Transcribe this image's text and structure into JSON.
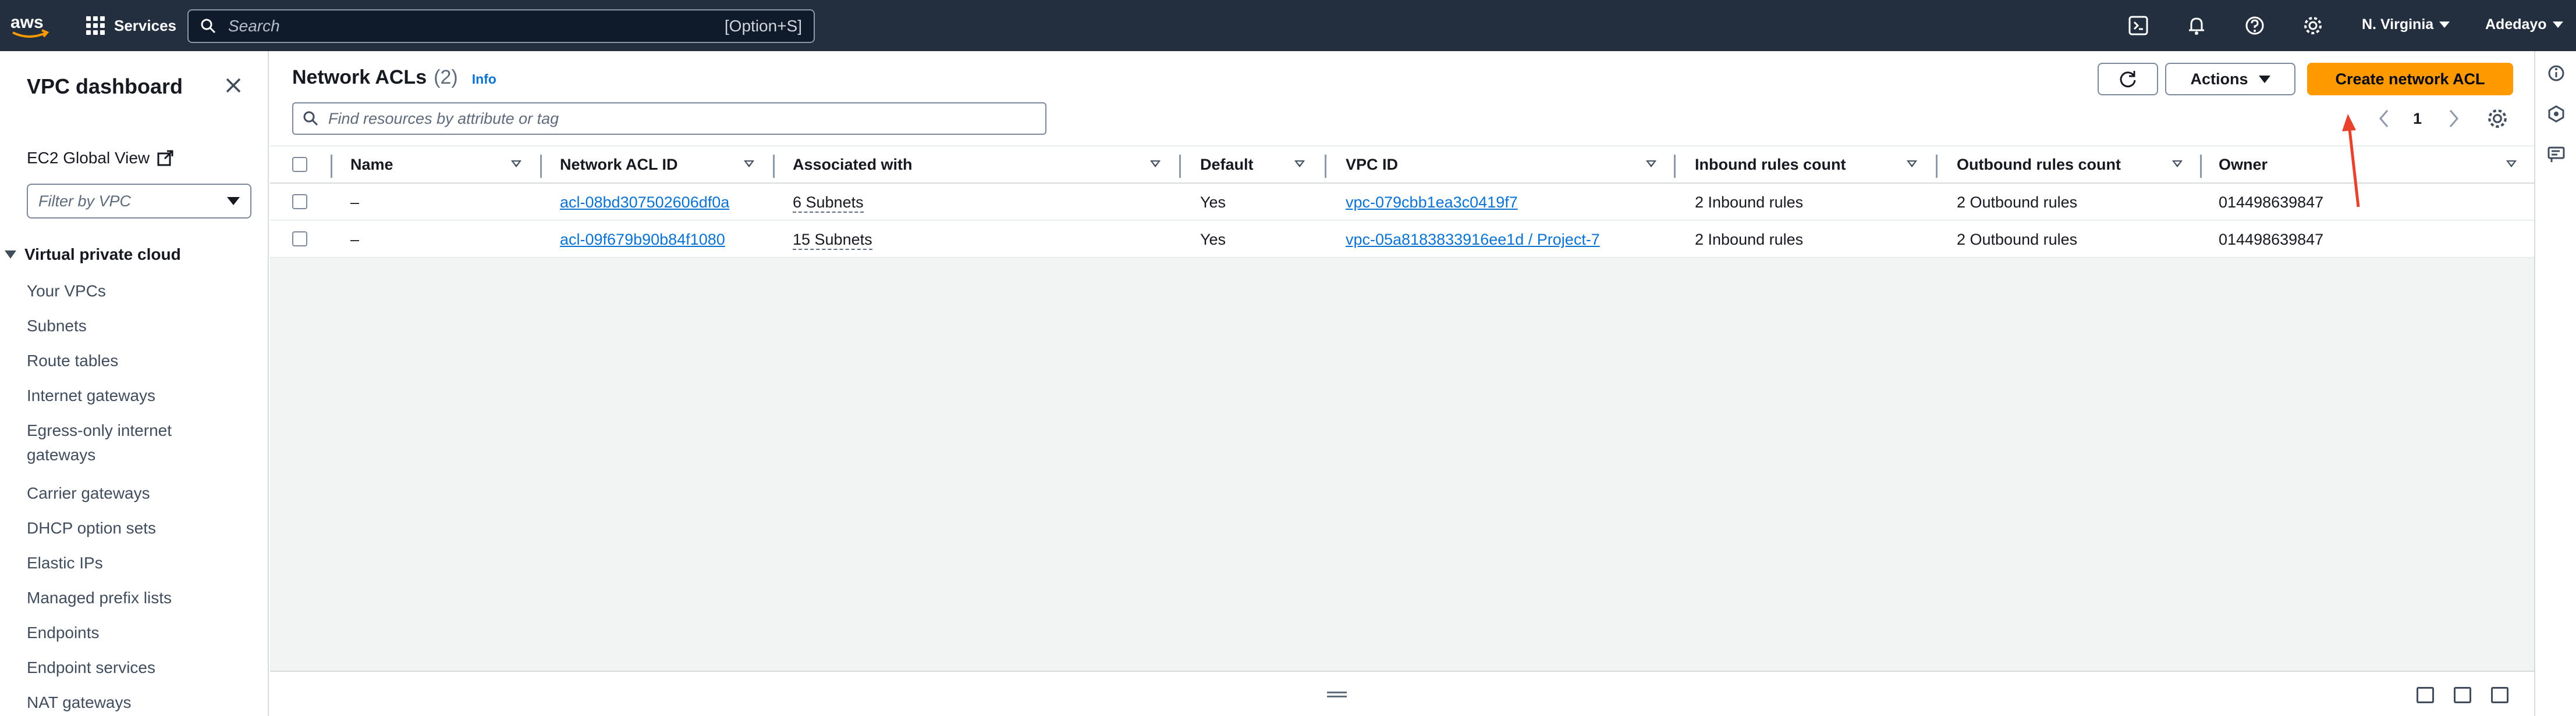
{
  "topbar": {
    "logo_text": "aws",
    "services_label": "Services",
    "search_placeholder": "Search",
    "search_shortcut": "[Option+S]",
    "icons": [
      "cloudshell-icon",
      "bell-icon",
      "help-icon",
      "gear-icon"
    ],
    "region": "N. Virginia",
    "user": "Adedayo"
  },
  "sidebar": {
    "title": "VPC dashboard",
    "ec2_global_view": "EC2 Global View",
    "filter_placeholder": "Filter by VPC",
    "section_label": "Virtual private cloud",
    "items": [
      "Your VPCs",
      "Subnets",
      "Route tables",
      "Internet gateways",
      "Egress-only internet gateways",
      "Carrier gateways",
      "DHCP option sets",
      "Elastic IPs",
      "Managed prefix lists",
      "Endpoints",
      "Endpoint services",
      "NAT gateways"
    ]
  },
  "main": {
    "title": "Network ACLs",
    "count": "(2)",
    "info": "Info",
    "actions_label": "Actions",
    "create_label": "Create network ACL",
    "filter_placeholder": "Find resources by attribute or tag",
    "page_number": "1"
  },
  "table": {
    "columns": [
      "Name",
      "Network ACL ID",
      "Associated with",
      "Default",
      "VPC ID",
      "Inbound rules count",
      "Outbound rules count",
      "Owner"
    ],
    "rows": [
      {
        "name": "–",
        "acl_id": "acl-08bd307502606df0a",
        "associated": "6 Subnets",
        "default": "Yes",
        "vpc_id": "vpc-079cbb1ea3c0419f7",
        "inbound": "2 Inbound rules",
        "outbound": "2 Outbound rules",
        "owner": "014498639847"
      },
      {
        "name": "–",
        "acl_id": "acl-09f679b90b84f1080",
        "associated": "15 Subnets",
        "default": "Yes",
        "vpc_id": "vpc-05a8183833916ee1d / Project-7",
        "inbound": "2 Inbound rules",
        "outbound": "2 Outbound rules",
        "owner": "014498639847"
      }
    ]
  },
  "colors": {
    "topbar": "#232f3e",
    "primary_button": "#ff9900",
    "link": "#0972d3",
    "annotation_arrow": "#e8412c"
  }
}
